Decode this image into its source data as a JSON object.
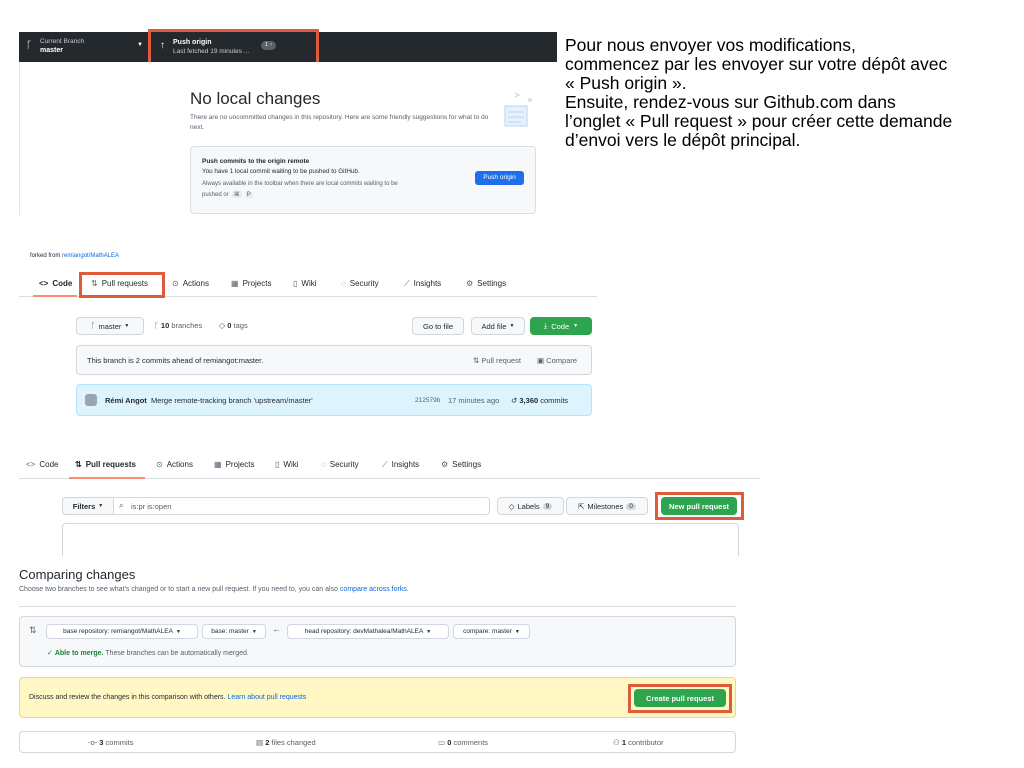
{
  "caption": {
    "lines": [
      "Pour nous envoyer vos modifications,",
      "commencez par les envoyer sur votre dépôt avec",
      "« Push origin ».",
      "Ensuite, rendez-vous sur Github.com  dans",
      "l’onglet « Pull request » pour créer cette demande",
      "d’envoi vers le dépôt principal."
    ]
  },
  "desktop": {
    "branch_label": "Current Branch",
    "branch_name": "master",
    "push_title": "Push origin",
    "push_sub": "Last fetched 19 minutes ...",
    "push_badge": "1 ↑",
    "heading": "No local changes",
    "description": "There are no uncommitted changes in this repository. Here are some friendly suggestions for what to do next.",
    "card_title": "Push commits to the origin remote",
    "card_line1": "You have 1 local commit waiting to be pushed to GitHub.",
    "card_line2": "Always available in the toolbar when there are local commits waiting to be",
    "card_line3_prefix": "pushed or",
    "card_key1": "⌘",
    "card_key2": "P",
    "card_button": "Push origin"
  },
  "repo": {
    "forked_label": "forked from",
    "forked_link": "remiangot/MathALEA",
    "tabs": [
      "Code",
      "Pull requests",
      "Actions",
      "Projects",
      "Wiki",
      "Security",
      "Insights",
      "Settings"
    ],
    "branch_button": "master",
    "branches_count": "10",
    "branches_label": "branches",
    "tags_count": "0",
    "tags_label": "tags",
    "go_to_file": "Go to file",
    "add_file": "Add file",
    "code_button": "Code",
    "ahead_text": "This branch is 2 commits ahead of remiangot:master.",
    "pull_request_link": "Pull request",
    "compare_link": "Compare",
    "commit_author": "Rémi Angot",
    "commit_message": "Merge remote-tracking branch 'upstream/master'",
    "commit_sha": "212579b",
    "commit_time": "17 minutes ago",
    "commits_count": "3,360",
    "commits_label": "commits"
  },
  "pulls": {
    "tabs": [
      "Code",
      "Pull requests",
      "Actions",
      "Projects",
      "Wiki",
      "Security",
      "Insights",
      "Settings"
    ],
    "filters": "Filters",
    "search_value": "is:pr is:open",
    "labels": "Labels",
    "labels_count": "9",
    "milestones": "Milestones",
    "milestones_count": "0",
    "new_pr": "New pull request"
  },
  "compare": {
    "title": "Comparing changes",
    "subtitle": "Choose two branches to see what’s changed or to start a new pull request. If you need to, you can also",
    "subtitle_link": "compare across forks.",
    "base_repo": "base repository: remiangot/MathALEA",
    "base": "base: master",
    "head_repo": "head repository: devMathalea/MathALEA",
    "compare": "compare: master",
    "merge_ok": "Able to merge.",
    "merge_text": "These branches can be automatically merged.",
    "discuss_text": "Discuss and review the changes in this comparison with others.",
    "discuss_link": "Learn about pull requests",
    "create_pr": "Create pull request",
    "stats": {
      "commits_count": "3",
      "commits_label": "commits",
      "files_count": "2",
      "files_label": "files changed",
      "comments_count": "0",
      "comments_label": "comments",
      "contributors_count": "1",
      "contributors_label": "contributor"
    }
  }
}
